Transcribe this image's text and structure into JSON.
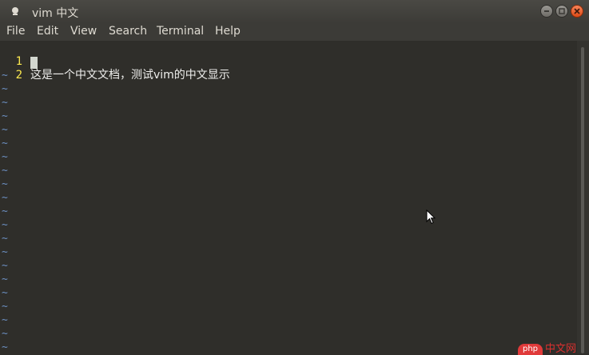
{
  "window": {
    "title": "vim 中文"
  },
  "menu": [
    "File",
    "Edit",
    "View",
    "Search",
    "Terminal",
    "Help"
  ],
  "editor": {
    "lines": [
      {
        "num": "1",
        "text": "这是一个中文文档，测试vim的中文显示"
      },
      {
        "num": "2",
        "text": ""
      }
    ],
    "tilde": "~"
  },
  "watermark": {
    "badge": "php",
    "text": "中文网"
  },
  "colors": {
    "background": "#2f2e2a",
    "line_number": "#fce94f",
    "tilde": "#6c8fc1",
    "text": "#eeeeec"
  }
}
